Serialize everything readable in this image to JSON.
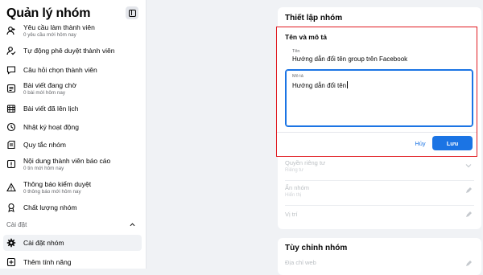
{
  "sidebar": {
    "title": "Quản lý nhóm",
    "items": [
      {
        "label": "Yêu cầu làm thành viên",
        "sub": "0 yêu cầu mới hôm nay",
        "icon": "member-request-icon"
      },
      {
        "label": "Tự động phê duyệt thành viên",
        "icon": "auto-approve-icon"
      },
      {
        "label": "Câu hỏi chọn thành viên",
        "icon": "question-icon"
      },
      {
        "label": "Bài viết đang chờ",
        "sub": "0 bài mới hôm nay",
        "icon": "pending-post-icon"
      },
      {
        "label": "Bài viết đã lên lịch",
        "icon": "calendar-icon"
      },
      {
        "label": "Nhật ký hoạt động",
        "icon": "clock-icon"
      },
      {
        "label": "Quy tắc nhóm",
        "icon": "rules-icon"
      },
      {
        "label": "Nội dung thành viên báo cáo",
        "sub": "0 tin mới hôm nay",
        "icon": "report-icon"
      },
      {
        "label": "Thông báo kiểm duyệt",
        "sub": "0 thông báo mới hôm nay",
        "icon": "alert-icon"
      },
      {
        "label": "Chất lượng nhóm",
        "icon": "quality-icon"
      }
    ],
    "section_label": "Cài đặt",
    "settings_items": [
      {
        "label": "Cài đặt nhóm",
        "icon": "gear-icon"
      },
      {
        "label": "Thêm tính năng",
        "icon": "add-feature-icon"
      }
    ]
  },
  "settings_card": {
    "title": "Thiết lập nhóm",
    "rows": [
      {
        "label": "Quyền riêng tư",
        "sub": "Riêng tư"
      },
      {
        "label": "Ẩn nhóm",
        "sub": "Hiển thị"
      },
      {
        "label": "Vị trí",
        "sub": ""
      }
    ]
  },
  "customize_card": {
    "title": "Tùy chỉnh nhóm",
    "rows": [
      {
        "label": "Địa chỉ web"
      }
    ]
  },
  "edit_panel": {
    "heading": "Tên và mô tả",
    "name_label": "Tên",
    "name_value": "Hướng dẫn đổi tên group trên Facebook",
    "desc_label": "Mô tả",
    "desc_value": "Hướng dẫn đổi tên",
    "cancel": "Hủy",
    "save": "Lưu"
  },
  "colors": {
    "accent": "#1b74e4",
    "highlight_border": "#e0191f"
  }
}
